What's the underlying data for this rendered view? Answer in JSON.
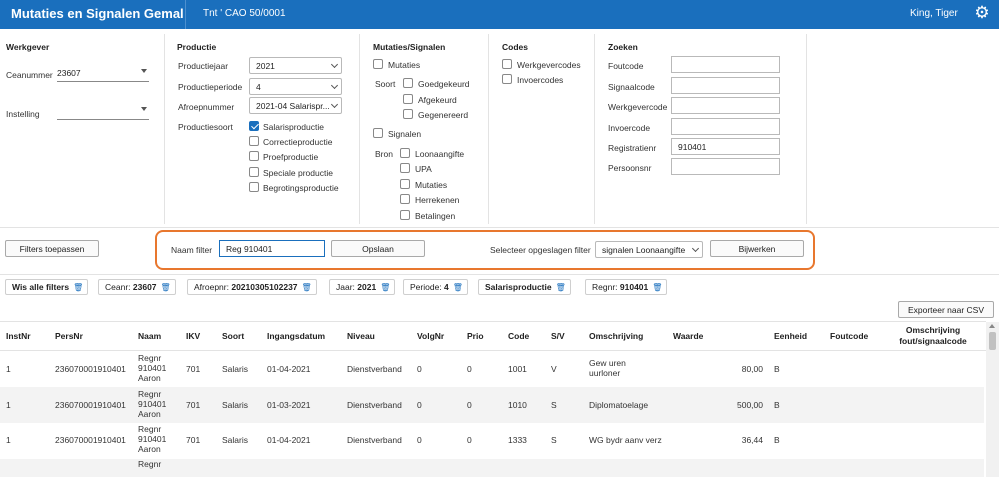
{
  "header": {
    "app_title": "Mutaties en Signalen Gemal",
    "org": "Tnt ' CAO 50/0001",
    "user": "King, Tiger",
    "settings_icon": "gear-icon"
  },
  "werkgever": {
    "title": "Werkgever",
    "ceanummer_label": "Ceanummer",
    "ceanummer_value": "23607",
    "instelling_label": "Instelling",
    "instelling_value": ""
  },
  "productie": {
    "title": "Productie",
    "jaar_label": "Productiejaar",
    "jaar_value": "2021",
    "periode_label": "Productieperiode",
    "periode_value": "4",
    "afroep_label": "Afroepnummer",
    "afroep_value": "2021-04 Salarispr...",
    "soort_label": "Productiesoort",
    "soorten": [
      {
        "label": "Salarisproductie",
        "checked": true
      },
      {
        "label": "Correctieproductie",
        "checked": false
      },
      {
        "label": "Proefproductie",
        "checked": false
      },
      {
        "label": "Speciale productie",
        "checked": false
      },
      {
        "label": "Begrotingsproductie",
        "checked": false
      }
    ]
  },
  "mutaties": {
    "title": "Mutaties/Signalen",
    "mutaties_label": "Mutaties",
    "soort_label": "Soort",
    "soorten": [
      "Goedgekeurd",
      "Afgekeurd",
      "Gegenereerd"
    ],
    "signalen_label": "Signalen",
    "bron_label": "Bron",
    "bronnen": [
      "Loonaangifte",
      "UPA",
      "Mutaties",
      "Herrekenen",
      "Betalingen"
    ]
  },
  "codes": {
    "title": "Codes",
    "items": [
      "Werkgevercodes",
      "Invoercodes"
    ]
  },
  "zoeken": {
    "title": "Zoeken",
    "fields": [
      {
        "label": "Foutcode",
        "value": ""
      },
      {
        "label": "Signaalcode",
        "value": ""
      },
      {
        "label": "Werkgevercode",
        "value": ""
      },
      {
        "label": "Invoercode",
        "value": ""
      },
      {
        "label": "Registratienr",
        "value": "910401"
      },
      {
        "label": "Persoonsnr",
        "value": ""
      }
    ]
  },
  "filterbar": {
    "apply_label": "Filters toepassen",
    "naam_filter_label": "Naam filter",
    "naam_filter_value": "Reg 910401",
    "save_label": "Opslaan",
    "select_label": "Selecteer opgeslagen filter",
    "select_value": "signalen Loonaangifte",
    "update_label": "Bijwerken",
    "highlight_color": "#e8772e"
  },
  "chips": {
    "clear_all": "Wis alle filters",
    "items": [
      {
        "key": "Ceanr:",
        "value": "23607"
      },
      {
        "key": "Afroepnr:",
        "value": "20210305102237"
      },
      {
        "key": "Jaar:",
        "value": "2021"
      },
      {
        "key": "Periode:",
        "value": "4"
      },
      {
        "key": "",
        "value": "Salarisproductie"
      },
      {
        "key": "Regnr:",
        "value": "910401"
      }
    ]
  },
  "export_label": "Exporteer naar CSV",
  "table": {
    "headers": [
      "InstNr",
      "PersNr",
      "Naam",
      "IKV",
      "Soort",
      "Ingangsdatum",
      "Niveau",
      "VolgNr",
      "Prio",
      "Code",
      "S/V",
      "Omschrijving",
      "Waarde",
      "Eenheid",
      "Foutcode",
      "Omschrijving fout/signaalcode"
    ],
    "rows": [
      [
        "1",
        "236070001910401",
        "Regnr 910401 Aaron",
        "701",
        "Salaris",
        "01-04-2021",
        "Dienstverband",
        "0",
        "0",
        "1001",
        "V",
        "Gew uren uurloner",
        "80,00",
        "B",
        "",
        ""
      ],
      [
        "1",
        "236070001910401",
        "Regnr 910401 Aaron",
        "701",
        "Salaris",
        "01-03-2021",
        "Dienstverband",
        "0",
        "0",
        "1010",
        "S",
        "Diplomatoelage",
        "500,00",
        "B",
        "",
        ""
      ],
      [
        "1",
        "236070001910401",
        "Regnr 910401 Aaron",
        "701",
        "Salaris",
        "01-04-2021",
        "Dienstverband",
        "0",
        "0",
        "1333",
        "S",
        "WG bydr aanv verz",
        "36,44",
        "B",
        "",
        ""
      ]
    ],
    "partial_row_name": "Regnr"
  },
  "colors": {
    "brand": "#1a6fbd",
    "highlight": "#e8772e"
  }
}
